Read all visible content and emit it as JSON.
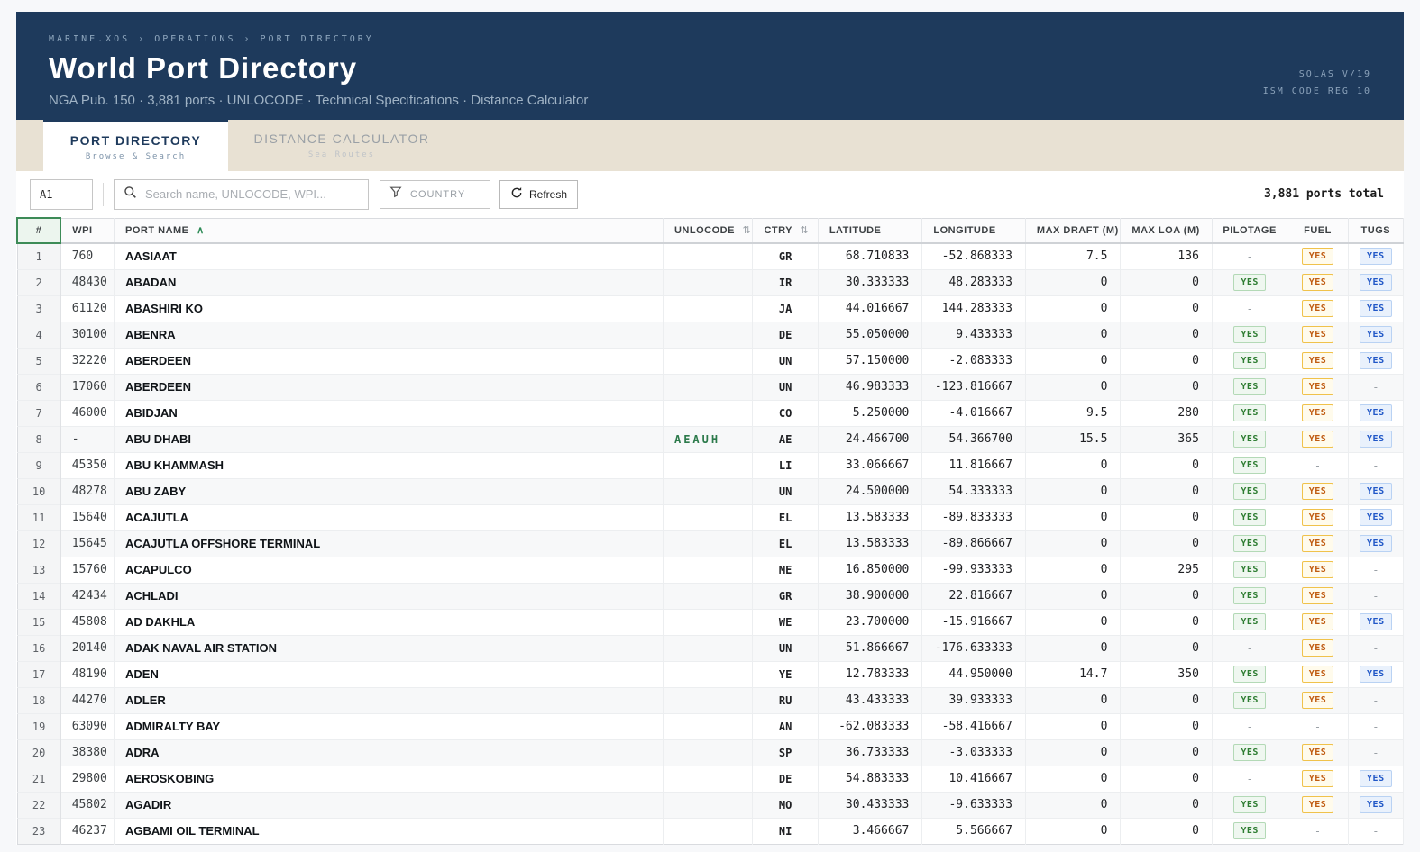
{
  "header": {
    "breadcrumb": "MARINE.XOS › OPERATIONS › PORT DIRECTORY",
    "title": "World Port Directory",
    "subtitle": "NGA Pub. 150 · 3,881 ports · UNLOCODE · Technical Specifications · Distance Calculator",
    "compliance_line1": "SOLAS V/19",
    "compliance_line2": "ISM CODE REG 10"
  },
  "tabs": [
    {
      "label": "PORT DIRECTORY",
      "sublabel": "Browse & Search",
      "active": true
    },
    {
      "label": "DISTANCE CALCULATOR",
      "sublabel": "Sea Routes",
      "active": false
    }
  ],
  "toolbar": {
    "cell_ref_value": "A1",
    "search_placeholder": "Search name, UNLOCODE, WPI...",
    "country_label": "COUNTRY",
    "refresh_label": "Refresh",
    "total_label": "3,881 ports total"
  },
  "icons": {
    "search": "magnifier",
    "country_filter": "funnel",
    "refresh": "circular-arrow",
    "sort_asc_glyph": "∧",
    "sort_both_glyph": "⇅"
  },
  "colors": {
    "header_bg": "#1e3a5c",
    "tabstrip_bg": "#e8e1d3",
    "accent_green": "#2e7d32",
    "badge_pilotage_text": "#2e7d32",
    "badge_fuel_text": "#c05c12",
    "badge_tugs_text": "#2057c7",
    "unlocode_green": "#2c7a4b"
  },
  "table": {
    "columns": [
      "#",
      "WPI",
      "PORT NAME",
      "UNLOCODE",
      "CTRY",
      "LATITUDE",
      "LONGITUDE",
      "MAX DRAFT (M)",
      "MAX LOA (M)",
      "PILOTAGE",
      "FUEL",
      "TUGS"
    ],
    "sort": {
      "column": "PORT NAME",
      "direction": "asc"
    },
    "rows": [
      {
        "n": "1",
        "wpi": "760",
        "name": "AASIAAT",
        "unlocode": "",
        "ctry": "GR",
        "lat": "68.710833",
        "lon": "-52.868333",
        "draft": "7.5",
        "loa": "136",
        "pilotage": "-",
        "fuel": "YES",
        "tugs": "YES"
      },
      {
        "n": "2",
        "wpi": "48430",
        "name": "ABADAN",
        "unlocode": "",
        "ctry": "IR",
        "lat": "30.333333",
        "lon": "48.283333",
        "draft": "0",
        "loa": "0",
        "pilotage": "YES",
        "fuel": "YES",
        "tugs": "YES"
      },
      {
        "n": "3",
        "wpi": "61120",
        "name": "ABASHIRI KO",
        "unlocode": "",
        "ctry": "JA",
        "lat": "44.016667",
        "lon": "144.283333",
        "draft": "0",
        "loa": "0",
        "pilotage": "-",
        "fuel": "YES",
        "tugs": "YES"
      },
      {
        "n": "4",
        "wpi": "30100",
        "name": "ABENRA",
        "unlocode": "",
        "ctry": "DE",
        "lat": "55.050000",
        "lon": "9.433333",
        "draft": "0",
        "loa": "0",
        "pilotage": "YES",
        "fuel": "YES",
        "tugs": "YES"
      },
      {
        "n": "5",
        "wpi": "32220",
        "name": "ABERDEEN",
        "unlocode": "",
        "ctry": "UN",
        "lat": "57.150000",
        "lon": "-2.083333",
        "draft": "0",
        "loa": "0",
        "pilotage": "YES",
        "fuel": "YES",
        "tugs": "YES"
      },
      {
        "n": "6",
        "wpi": "17060",
        "name": "ABERDEEN",
        "unlocode": "",
        "ctry": "UN",
        "lat": "46.983333",
        "lon": "-123.816667",
        "draft": "0",
        "loa": "0",
        "pilotage": "YES",
        "fuel": "YES",
        "tugs": "-"
      },
      {
        "n": "7",
        "wpi": "46000",
        "name": "ABIDJAN",
        "unlocode": "",
        "ctry": "CO",
        "lat": "5.250000",
        "lon": "-4.016667",
        "draft": "9.5",
        "loa": "280",
        "pilotage": "YES",
        "fuel": "YES",
        "tugs": "YES"
      },
      {
        "n": "8",
        "wpi": "-",
        "name": "ABU DHABI",
        "unlocode": "AEAUH",
        "ctry": "AE",
        "lat": "24.466700",
        "lon": "54.366700",
        "draft": "15.5",
        "loa": "365",
        "pilotage": "YES",
        "fuel": "YES",
        "tugs": "YES"
      },
      {
        "n": "9",
        "wpi": "45350",
        "name": "ABU KHAMMASH",
        "unlocode": "",
        "ctry": "LI",
        "lat": "33.066667",
        "lon": "11.816667",
        "draft": "0",
        "loa": "0",
        "pilotage": "YES",
        "fuel": "-",
        "tugs": "-"
      },
      {
        "n": "10",
        "wpi": "48278",
        "name": "ABU ZABY",
        "unlocode": "",
        "ctry": "UN",
        "lat": "24.500000",
        "lon": "54.333333",
        "draft": "0",
        "loa": "0",
        "pilotage": "YES",
        "fuel": "YES",
        "tugs": "YES"
      },
      {
        "n": "11",
        "wpi": "15640",
        "name": "ACAJUTLA",
        "unlocode": "",
        "ctry": "EL",
        "lat": "13.583333",
        "lon": "-89.833333",
        "draft": "0",
        "loa": "0",
        "pilotage": "YES",
        "fuel": "YES",
        "tugs": "YES"
      },
      {
        "n": "12",
        "wpi": "15645",
        "name": "ACAJUTLA OFFSHORE TERMINAL",
        "unlocode": "",
        "ctry": "EL",
        "lat": "13.583333",
        "lon": "-89.866667",
        "draft": "0",
        "loa": "0",
        "pilotage": "YES",
        "fuel": "YES",
        "tugs": "YES"
      },
      {
        "n": "13",
        "wpi": "15760",
        "name": "ACAPULCO",
        "unlocode": "",
        "ctry": "ME",
        "lat": "16.850000",
        "lon": "-99.933333",
        "draft": "0",
        "loa": "295",
        "pilotage": "YES",
        "fuel": "YES",
        "tugs": "-"
      },
      {
        "n": "14",
        "wpi": "42434",
        "name": "ACHLADI",
        "unlocode": "",
        "ctry": "GR",
        "lat": "38.900000",
        "lon": "22.816667",
        "draft": "0",
        "loa": "0",
        "pilotage": "YES",
        "fuel": "YES",
        "tugs": "-"
      },
      {
        "n": "15",
        "wpi": "45808",
        "name": "AD DAKHLA",
        "unlocode": "",
        "ctry": "WE",
        "lat": "23.700000",
        "lon": "-15.916667",
        "draft": "0",
        "loa": "0",
        "pilotage": "YES",
        "fuel": "YES",
        "tugs": "YES"
      },
      {
        "n": "16",
        "wpi": "20140",
        "name": "ADAK NAVAL AIR STATION",
        "unlocode": "",
        "ctry": "UN",
        "lat": "51.866667",
        "lon": "-176.633333",
        "draft": "0",
        "loa": "0",
        "pilotage": "-",
        "fuel": "YES",
        "tugs": "-"
      },
      {
        "n": "17",
        "wpi": "48190",
        "name": "ADEN",
        "unlocode": "",
        "ctry": "YE",
        "lat": "12.783333",
        "lon": "44.950000",
        "draft": "14.7",
        "loa": "350",
        "pilotage": "YES",
        "fuel": "YES",
        "tugs": "YES"
      },
      {
        "n": "18",
        "wpi": "44270",
        "name": "ADLER",
        "unlocode": "",
        "ctry": "RU",
        "lat": "43.433333",
        "lon": "39.933333",
        "draft": "0",
        "loa": "0",
        "pilotage": "YES",
        "fuel": "YES",
        "tugs": "-"
      },
      {
        "n": "19",
        "wpi": "63090",
        "name": "ADMIRALTY BAY",
        "unlocode": "",
        "ctry": "AN",
        "lat": "-62.083333",
        "lon": "-58.416667",
        "draft": "0",
        "loa": "0",
        "pilotage": "-",
        "fuel": "-",
        "tugs": "-"
      },
      {
        "n": "20",
        "wpi": "38380",
        "name": "ADRA",
        "unlocode": "",
        "ctry": "SP",
        "lat": "36.733333",
        "lon": "-3.033333",
        "draft": "0",
        "loa": "0",
        "pilotage": "YES",
        "fuel": "YES",
        "tugs": "-"
      },
      {
        "n": "21",
        "wpi": "29800",
        "name": "AEROSKOBING",
        "unlocode": "",
        "ctry": "DE",
        "lat": "54.883333",
        "lon": "10.416667",
        "draft": "0",
        "loa": "0",
        "pilotage": "-",
        "fuel": "YES",
        "tugs": "YES"
      },
      {
        "n": "22",
        "wpi": "45802",
        "name": "AGADIR",
        "unlocode": "",
        "ctry": "MO",
        "lat": "30.433333",
        "lon": "-9.633333",
        "draft": "0",
        "loa": "0",
        "pilotage": "YES",
        "fuel": "YES",
        "tugs": "YES"
      },
      {
        "n": "23",
        "wpi": "46237",
        "name": "AGBAMI OIL TERMINAL",
        "unlocode": "",
        "ctry": "NI",
        "lat": "3.466667",
        "lon": "5.566667",
        "draft": "0",
        "loa": "0",
        "pilotage": "YES",
        "fuel": "-",
        "tugs": "-"
      }
    ]
  }
}
